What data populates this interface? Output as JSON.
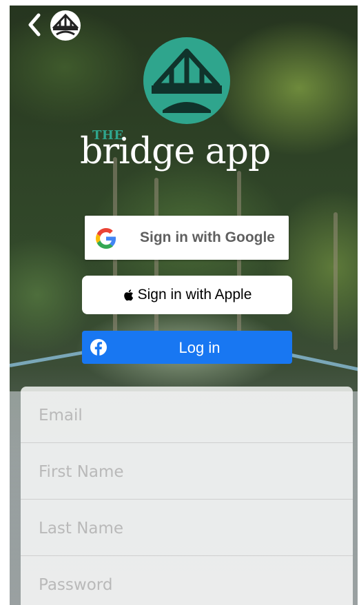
{
  "header": {
    "back_icon": "chevron-left-icon",
    "small_logo_icon": "bridge-logo-icon"
  },
  "brand": {
    "logo_icon": "bridge-logo-icon",
    "the": "THE",
    "name": "bridge app",
    "accent_color": "#2fa58d"
  },
  "auth": {
    "google_label": "Sign in with Google",
    "apple_label": "Sign in with Apple",
    "facebook_label": "Log in",
    "facebook_color": "#1877f2"
  },
  "form": {
    "email_placeholder": "Email",
    "first_name_placeholder": "First Name",
    "last_name_placeholder": "Last Name",
    "password_placeholder": "Password"
  }
}
